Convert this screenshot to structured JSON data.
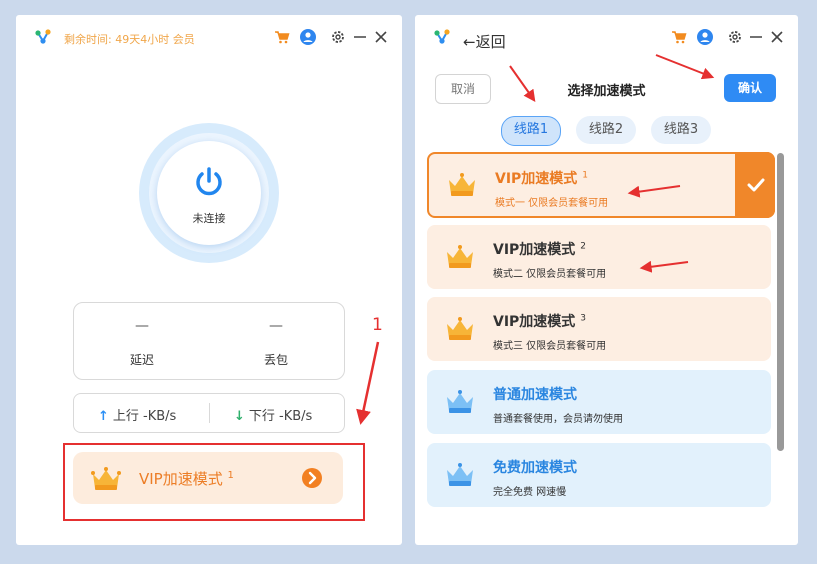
{
  "left_window": {
    "remaining_label": "剩余时间: 49天4小时 会员",
    "connection_status": "未连接",
    "latency": {
      "value": "—",
      "label": "延迟"
    },
    "packet_loss": {
      "value": "—",
      "label": "丢包"
    },
    "upload": {
      "arrow": "↑",
      "label": "上行 -KB/s"
    },
    "download": {
      "arrow": "↓",
      "label": "下行 -KB/s"
    },
    "mode_button": {
      "text": "VIP加速模式",
      "sup": "1"
    },
    "annotation_number": "1"
  },
  "right_window": {
    "back_arrow": "←",
    "back_label": "返回",
    "cancel_label": "取消",
    "title": "选择加速模式",
    "confirm_label": "确认",
    "routes": [
      "线路1",
      "线路2",
      "线路3"
    ],
    "modes": [
      {
        "title": "VIP加速模式",
        "sup": "1",
        "desc": "模式一 仅限会员套餐可用"
      },
      {
        "title": "VIP加速模式",
        "sup": "2",
        "desc": "模式二 仅限会员套餐可用"
      },
      {
        "title": "VIP加速模式",
        "sup": "3",
        "desc": "模式三 仅限会员套餐可用"
      },
      {
        "title": "普通加速模式",
        "desc": "普通套餐使用，会员请勿使用"
      },
      {
        "title": "免费加速模式",
        "desc": "完全免费 网速慢"
      }
    ]
  },
  "icons": [
    "logo-icon",
    "cart-icon",
    "user-icon",
    "settings-icon",
    "minimize-icon",
    "close-icon",
    "power-icon",
    "crown-icon",
    "chevron-right-icon",
    "check-icon"
  ],
  "colors": {
    "accent_blue": "#2f8bf4",
    "accent_orange": "#f0872a",
    "annotation_red": "#e53030"
  }
}
